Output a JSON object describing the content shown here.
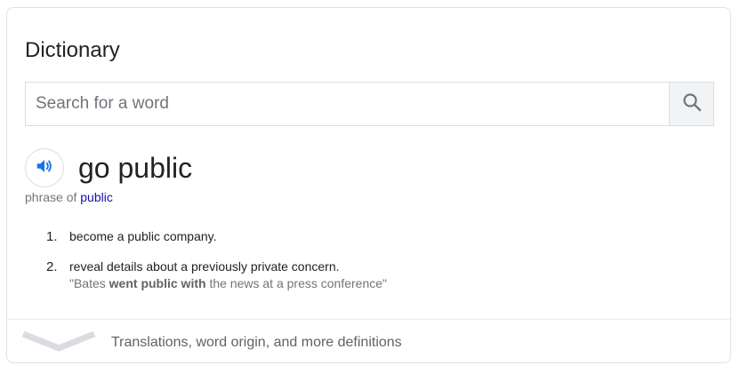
{
  "card": {
    "title": "Dictionary"
  },
  "search": {
    "placeholder": "Search for a word",
    "value": "",
    "button_icon": "search-icon"
  },
  "entry": {
    "audio_icon": "speaker-icon",
    "headword": "go public",
    "phrase_of_prefix": "phrase of",
    "phrase_of_link": "public",
    "definitions": [
      {
        "number": "1.",
        "text": "become a public company."
      },
      {
        "number": "2.",
        "text": "reveal details about a previously private concern.",
        "example_open": "\"Bates ",
        "example_bold": "went public with",
        "example_close": " the news at a press conference\""
      }
    ]
  },
  "more": {
    "icon": "chevron-down-icon",
    "label": "Translations, word origin, and more definitions"
  },
  "colors": {
    "link": "#1a0dab",
    "audio_icon": "#1a73e8",
    "border": "#dfe1e5",
    "muted_text": "#70757a"
  }
}
